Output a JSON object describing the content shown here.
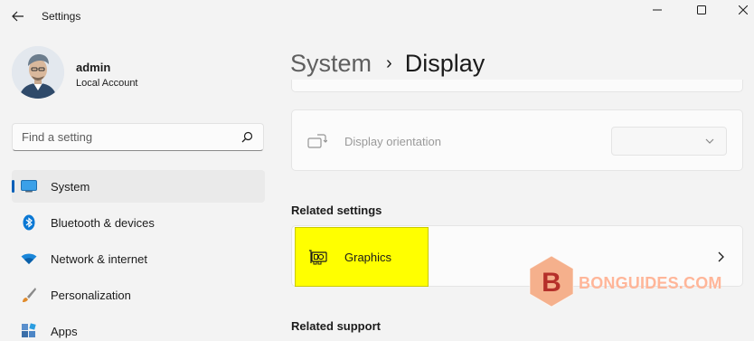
{
  "window": {
    "title": "Settings"
  },
  "profile": {
    "name": "admin",
    "account_type": "Local Account"
  },
  "search": {
    "placeholder": "Find a setting"
  },
  "sidebar": {
    "items": [
      {
        "label": "System",
        "icon": "system-icon",
        "selected": true
      },
      {
        "label": "Bluetooth & devices",
        "icon": "bluetooth-icon",
        "selected": false
      },
      {
        "label": "Network & internet",
        "icon": "wifi-icon",
        "selected": false
      },
      {
        "label": "Personalization",
        "icon": "brush-icon",
        "selected": false
      },
      {
        "label": "Apps",
        "icon": "apps-icon",
        "selected": false
      }
    ]
  },
  "breadcrumb": {
    "parent": "System",
    "separator": "›",
    "current": "Display"
  },
  "display_orientation": {
    "label": "Display orientation",
    "value": ""
  },
  "related_settings": {
    "title": "Related settings",
    "graphics_label": "Graphics"
  },
  "related_support": {
    "title": "Related support"
  },
  "watermark": {
    "text": "BONGUIDES.COM",
    "logo_letter": "B"
  },
  "colors": {
    "accent": "#005fb8",
    "highlight": "#ffff00",
    "watermark": "#ff9a70"
  }
}
